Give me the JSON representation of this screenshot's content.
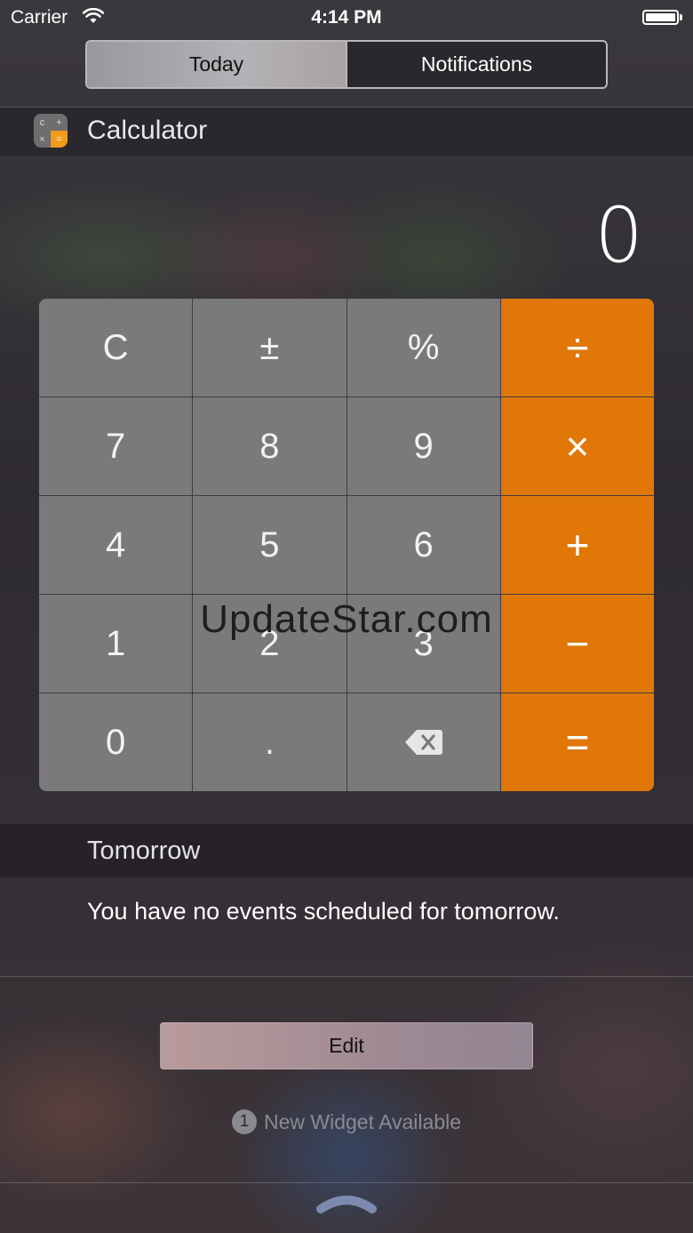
{
  "status_bar": {
    "carrier": "Carrier",
    "time": "4:14 PM"
  },
  "segments": [
    {
      "label": "Today",
      "selected": true
    },
    {
      "label": "Notifications",
      "selected": false
    }
  ],
  "calculator": {
    "title": "Calculator",
    "icon_glyphs": [
      "c",
      "+",
      "×",
      "="
    ],
    "display": "0",
    "keys": [
      {
        "label": "C",
        "type": "function"
      },
      {
        "label": "±",
        "type": "function"
      },
      {
        "label": "%",
        "type": "function"
      },
      {
        "label": "÷",
        "type": "operator"
      },
      {
        "label": "7",
        "type": "digit"
      },
      {
        "label": "8",
        "type": "digit"
      },
      {
        "label": "9",
        "type": "digit"
      },
      {
        "label": "×",
        "type": "operator"
      },
      {
        "label": "4",
        "type": "digit"
      },
      {
        "label": "5",
        "type": "digit"
      },
      {
        "label": "6",
        "type": "digit"
      },
      {
        "label": "+",
        "type": "operator"
      },
      {
        "label": "1",
        "type": "digit"
      },
      {
        "label": "2",
        "type": "digit"
      },
      {
        "label": "3",
        "type": "digit"
      },
      {
        "label": "−",
        "type": "operator"
      },
      {
        "label": "0",
        "type": "digit"
      },
      {
        "label": ".",
        "type": "digit"
      },
      {
        "label": "",
        "type": "backspace",
        "icon": "backspace-icon"
      },
      {
        "label": "=",
        "type": "operator"
      }
    ],
    "operator_color": "#e07707"
  },
  "watermark": "UpdateStar.com",
  "tomorrow": {
    "title": "Tomorrow",
    "message": "You have no events scheduled for tomorrow."
  },
  "edit_button": {
    "label": "Edit"
  },
  "new_widget": {
    "count": "1",
    "label": "New Widget Available"
  }
}
